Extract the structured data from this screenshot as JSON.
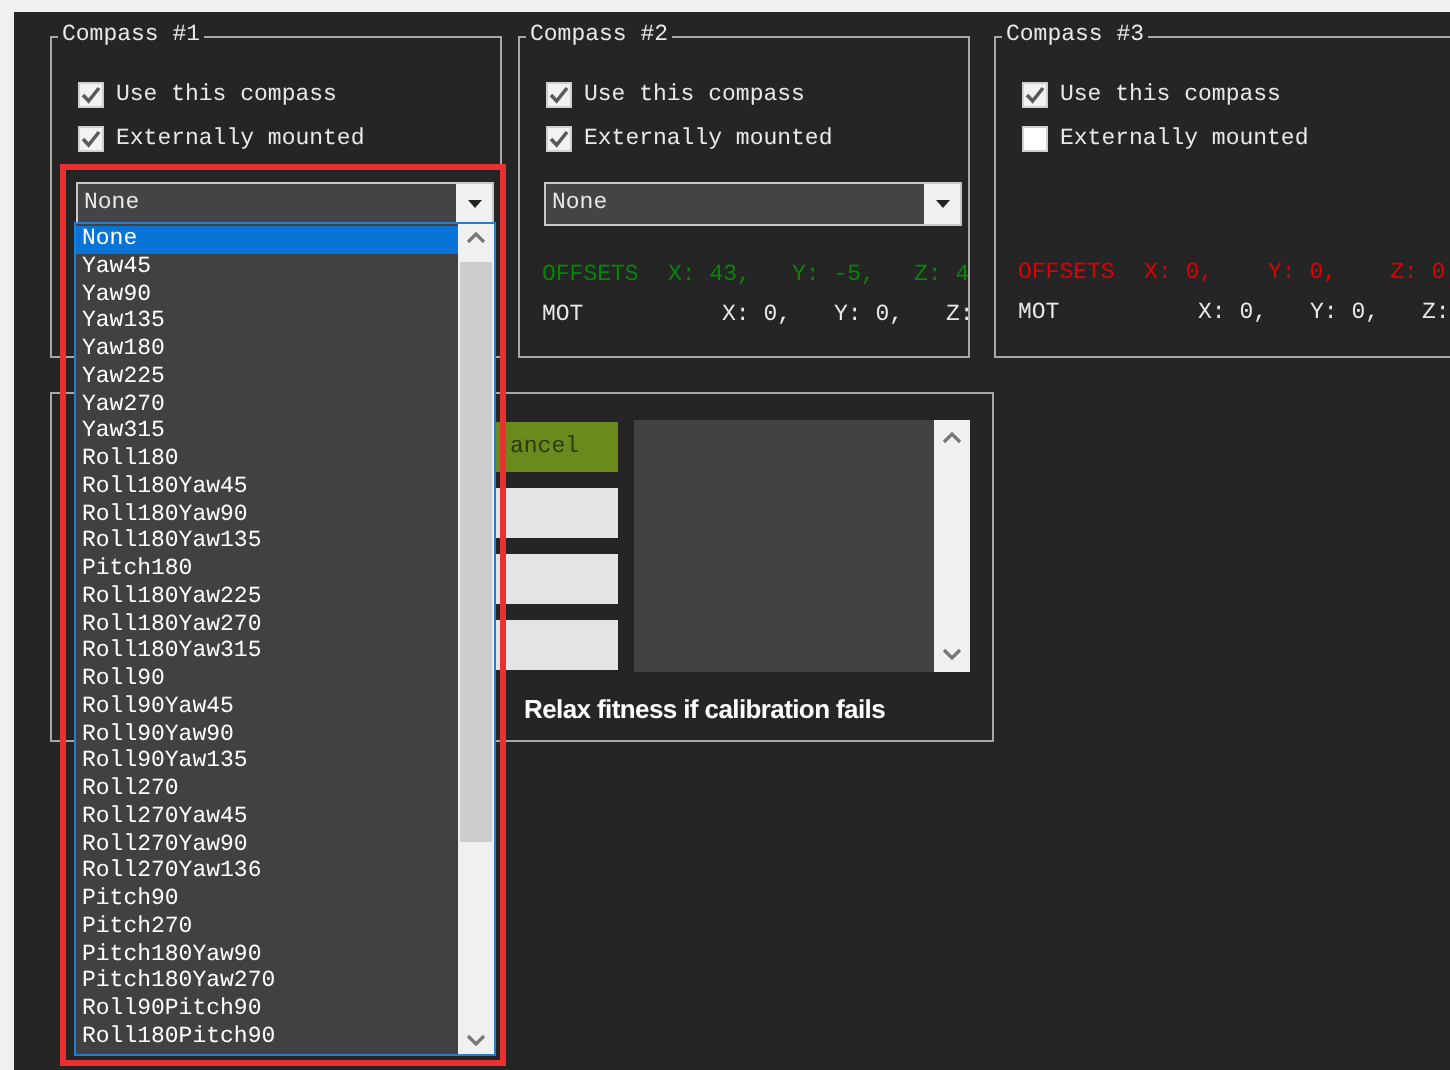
{
  "compasses": [
    {
      "title": "Compass #1",
      "options": [
        {
          "label": "Use this compass",
          "checked": true
        },
        {
          "label": "Externally mounted",
          "checked": true
        }
      ],
      "orientation": {
        "value": "None",
        "items": [
          {
            "label": "None",
            "selected": true
          },
          {
            "label": "Yaw45",
            "selected": false
          },
          {
            "label": "Yaw90",
            "selected": false
          },
          {
            "label": "Yaw135",
            "selected": false
          },
          {
            "label": "Yaw180",
            "selected": false
          },
          {
            "label": "Yaw225",
            "selected": false
          },
          {
            "label": "Yaw270",
            "selected": false
          },
          {
            "label": "Yaw315",
            "selected": false
          },
          {
            "label": "Roll180",
            "selected": false
          },
          {
            "label": "Roll180Yaw45",
            "selected": false
          },
          {
            "label": "Roll180Yaw90",
            "selected": false
          },
          {
            "label": "Roll180Yaw135",
            "selected": false
          },
          {
            "label": "Pitch180",
            "selected": false
          },
          {
            "label": "Roll180Yaw225",
            "selected": false
          },
          {
            "label": "Roll180Yaw270",
            "selected": false
          },
          {
            "label": "Roll180Yaw315",
            "selected": false
          },
          {
            "label": "Roll90",
            "selected": false
          },
          {
            "label": "Roll90Yaw45",
            "selected": false
          },
          {
            "label": "Roll90Yaw90",
            "selected": false
          },
          {
            "label": "Roll90Yaw135",
            "selected": false
          },
          {
            "label": "Roll270",
            "selected": false
          },
          {
            "label": "Roll270Yaw45",
            "selected": false
          },
          {
            "label": "Roll270Yaw90",
            "selected": false
          },
          {
            "label": "Roll270Yaw136",
            "selected": false
          },
          {
            "label": "Pitch90",
            "selected": false
          },
          {
            "label": "Pitch270",
            "selected": false
          },
          {
            "label": "Pitch180Yaw90",
            "selected": false
          },
          {
            "label": "Pitch180Yaw270",
            "selected": false
          },
          {
            "label": "Roll90Pitch90",
            "selected": false
          },
          {
            "label": "Roll180Pitch90",
            "selected": false
          }
        ]
      }
    },
    {
      "title": "Compass #2",
      "options": [
        {
          "label": "Use this compass",
          "checked": true
        },
        {
          "label": "Externally mounted",
          "checked": true
        }
      ],
      "orientation": {
        "value": "None"
      },
      "color": "#078507",
      "offsets": {
        "label": "OFFSETS",
        "x": "X: 43,",
        "y": "Y: -5,",
        "z": "Z: 4"
      },
      "mot": {
        "label": "MOT",
        "x": "X: 0,",
        "y": "Y: 0,",
        "z": "Z:"
      }
    },
    {
      "title": "Compass #3",
      "options": [
        {
          "label": "Use this compass",
          "checked": true
        },
        {
          "label": "Externally mounted",
          "checked": false
        }
      ],
      "color": "#e00000",
      "offsets": {
        "label": "OFFSETS",
        "x": "X: 0,",
        "y": "Y: 0,",
        "z": "Z: 0"
      },
      "mot": {
        "label": "MOT",
        "x": "X: 0,",
        "y": "Y: 0,",
        "z": "Z:"
      }
    }
  ],
  "calibration": {
    "cancel_button": "ancel",
    "relax_label": "Relax fitness if calibration fails"
  }
}
